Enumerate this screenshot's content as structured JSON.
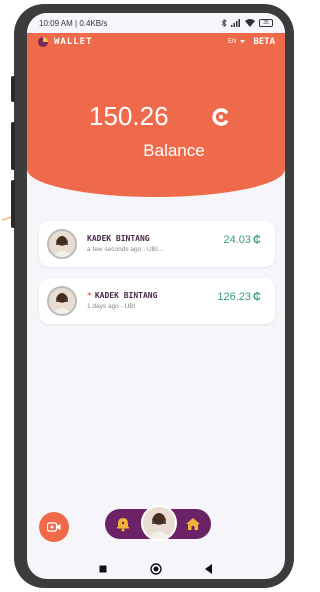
{
  "status_bar": {
    "time_speed": "10:09 AM | 0.4KB/s",
    "battery": "35"
  },
  "app": {
    "title": "WALLET",
    "language": "EN",
    "beta_label": "BETA"
  },
  "balance": {
    "value": "150.26",
    "label": "Balance"
  },
  "transactions": [
    {
      "name": "KADEK BINTANG",
      "starred": false,
      "subtitle": "a few seconds ago - UBI...",
      "amount": "24.03",
      "currency_symbol": "₵"
    },
    {
      "name": "KADEK BINTANG",
      "starred": true,
      "star": "*",
      "subtitle": "1 days ago - UBI",
      "amount": "126.23",
      "currency_symbol": "₵"
    }
  ],
  "colors": {
    "accent": "#ef6a4b",
    "nav_purple": "#6b2266",
    "amount_green": "#3aa07a",
    "background": "#f6f6fa"
  },
  "icons": {
    "camera": "camera-icon",
    "bell": "bell-icon",
    "home": "home-icon",
    "currency": "currency-c-icon"
  }
}
